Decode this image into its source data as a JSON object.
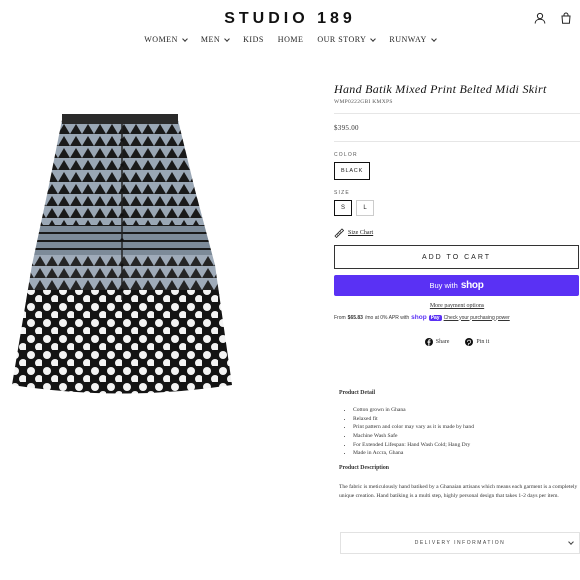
{
  "header": {
    "logo": "STUDIO 189",
    "icons": [
      "user-icon",
      "cart-icon"
    ],
    "nav": [
      {
        "label": "WOMEN",
        "dropdown": true
      },
      {
        "label": "MEN",
        "dropdown": true
      },
      {
        "label": "KIDS",
        "dropdown": false
      },
      {
        "label": "HOME",
        "dropdown": false
      },
      {
        "label": "OUR STORY",
        "dropdown": true
      },
      {
        "label": "RUNWAY",
        "dropdown": true
      }
    ]
  },
  "product": {
    "title": "Hand Batik Mixed Print Belted Midi Skirt",
    "sku": "WMP0222GBI KMXPS",
    "price": "$395.00",
    "color_label": "COLOR",
    "color_value": "BLACK",
    "size_label": "SIZE",
    "sizes": [
      "S",
      "L"
    ],
    "selected_size": "S",
    "size_chart": "Size Chart",
    "add_to_cart": "ADD TO CART",
    "buy_with": "Buy with",
    "shop_label": "shop",
    "more_payment": "More payment options",
    "installments": {
      "prefix": "From ",
      "amount": "$65.83",
      "suffix": "/mo at 0% APR with",
      "brand": "shop",
      "brand_tag": "Pay",
      "link": "Check your purchasing power"
    },
    "share": "Share",
    "pin": "Pin it"
  },
  "details": {
    "heading": "Product Detail",
    "bullets": [
      "Cotton grown in Ghana",
      "Relaxed fit",
      "Print pattern and color may vary as it is made by hand",
      "Machine Wash Safe",
      "For Extended Lifespan: Hand Wash Cold; Hang Dry",
      "Made in Accra, Ghana"
    ],
    "description_heading": "Product Description",
    "description": "The fabric is meticulously hand batiked by a Ghanaian artisans which means  each garment is a completely unique creation.  Hand batiking is a multi step, highly personal design that takes 1-2 days per item.",
    "delivery": "DELIVERY INFORMATION"
  },
  "colors": {
    "shop_pay": "#5a31f4",
    "skirt_light": "#9aa7b5",
    "skirt_dark": "#141414"
  }
}
